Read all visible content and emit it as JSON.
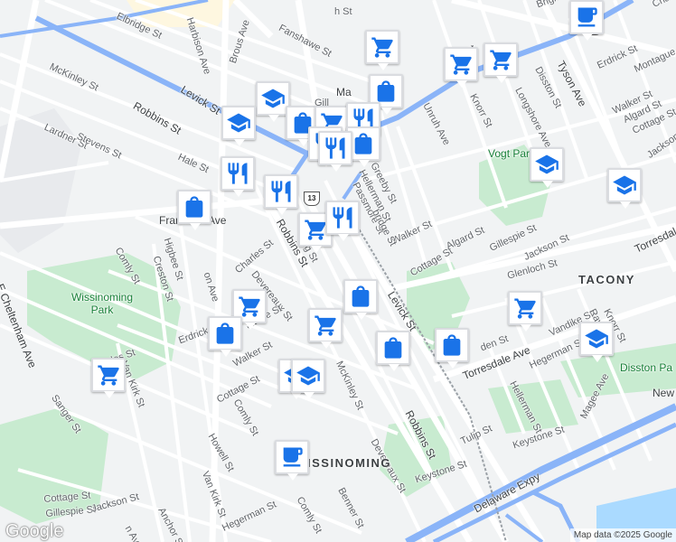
{
  "attribution": "Map data ©2025 Google",
  "logo": "Google",
  "shield_label": "13",
  "street_labels": [
    {
      "text": "Elbridge St",
      "key": "elbridge"
    },
    {
      "text": "Harbison Ave",
      "key": "harbison"
    },
    {
      "text": "Brous Ave",
      "key": "brous"
    },
    {
      "text": "Fanshawe St",
      "key": "fanshawe"
    },
    {
      "text": "Brighton St",
      "key": "brighton"
    },
    {
      "text": "McKinley St",
      "key": "mckinley1"
    },
    {
      "text": "Levick St",
      "key": "levick1"
    },
    {
      "text": "Robbins St",
      "key": "robbins1"
    },
    {
      "text": "Lardner St",
      "key": "lardner"
    },
    {
      "text": "Stevens St",
      "key": "stevens"
    },
    {
      "text": "Hale St",
      "key": "hale"
    },
    {
      "text": "Frankford Ave",
      "key": "frankford"
    },
    {
      "text": "Higbee St",
      "key": "higbee"
    },
    {
      "text": "Creston St",
      "key": "creston"
    },
    {
      "text": "Comly St",
      "key": "comly1"
    },
    {
      "text": "Charles St",
      "key": "charles"
    },
    {
      "text": "Devereaux St",
      "key": "devereaux1"
    },
    {
      "text": "Robbins St",
      "key": "robbins2"
    },
    {
      "text": "E Cheltenham Ave",
      "key": "cheltenham"
    },
    {
      "text": "Erdrick St",
      "key": "erdrick1"
    },
    {
      "text": "Walker St",
      "key": "walker1"
    },
    {
      "text": "Cottage St",
      "key": "cottage1"
    },
    {
      "text": "Comly St",
      "key": "comly2"
    },
    {
      "text": "Howell St",
      "key": "howell"
    },
    {
      "text": "Van Kirk St",
      "key": "vankirk1"
    },
    {
      "text": "Van Kirk St",
      "key": "vankirk2"
    },
    {
      "text": "Sanger St",
      "key": "sanger"
    },
    {
      "text": "Cottage St",
      "key": "cottage2"
    },
    {
      "text": "Gillespie St",
      "key": "gillespie1"
    },
    {
      "text": "Jackson St",
      "key": "jackson1"
    },
    {
      "text": "Anchor St",
      "key": "anchor"
    },
    {
      "text": "McKinley St",
      "key": "mckinley2"
    },
    {
      "text": "Devereaux St",
      "key": "devereaux2"
    },
    {
      "text": "Comly St",
      "key": "comly3"
    },
    {
      "text": "Benner St",
      "key": "benner"
    },
    {
      "text": "Robbins St",
      "key": "robbins3"
    },
    {
      "text": "Keystone St",
      "key": "keystone1"
    },
    {
      "text": "Tulip St",
      "key": "tulip"
    },
    {
      "text": "Levick St",
      "key": "levick2"
    },
    {
      "text": "Walker St",
      "key": "walker2"
    },
    {
      "text": "Cottage St",
      "key": "cottage3"
    },
    {
      "text": "Greeby St",
      "key": "greeby"
    },
    {
      "text": "Hellerman St",
      "key": "hellerman1"
    },
    {
      "text": "Passmore St",
      "key": "passmore"
    },
    {
      "text": "Unruh Ave",
      "key": "unruh"
    },
    {
      "text": "Knorr St",
      "key": "knorr1"
    },
    {
      "text": "Disston St",
      "key": "disston"
    },
    {
      "text": "Longshore Ave",
      "key": "longshore"
    },
    {
      "text": "Tyson Ave",
      "key": "tyson"
    },
    {
      "text": "Erdrick St",
      "key": "erdrick2"
    },
    {
      "text": "Montague St",
      "key": "montague"
    },
    {
      "text": "Walker St",
      "key": "walker3"
    },
    {
      "text": "Algard St",
      "key": "algard1"
    },
    {
      "text": "Cottage St",
      "key": "cottage4"
    },
    {
      "text": "Jackson St",
      "key": "jackson2"
    },
    {
      "text": "Algard St",
      "key": "algard2"
    },
    {
      "text": "Gillespie St",
      "key": "gillespie2"
    },
    {
      "text": "Jackson St",
      "key": "jackson3"
    },
    {
      "text": "Glenloch St",
      "key": "glenloch"
    },
    {
      "text": "Torresdale Ave",
      "key": "torresdale1"
    },
    {
      "text": "Torresdale Ave",
      "key": "torresdale2"
    },
    {
      "text": "Knorr St",
      "key": "knorr2"
    },
    {
      "text": "Vandike St",
      "key": "vandike"
    },
    {
      "text": "Hegerman St",
      "key": "hegerman1"
    },
    {
      "text": "Hellerman St",
      "key": "hellerman2"
    },
    {
      "text": "Magee Ave",
      "key": "magee"
    },
    {
      "text": "Keystone St",
      "key": "keystone2"
    },
    {
      "text": "Delaware Expy",
      "key": "delaware"
    },
    {
      "text": "Hegerman St",
      "key": "hegerman2"
    },
    {
      "text": "Chan",
      "key": "chan"
    },
    {
      "text": "Ma",
      "key": "ma"
    },
    {
      "text": "Gill",
      "key": "gill"
    },
    {
      "text": "bridge St",
      "key": "bridge"
    },
    {
      "text": "aitage St",
      "key": "aitage"
    },
    {
      "text": "rles St",
      "key": "rles"
    },
    {
      "text": "on Ave",
      "key": "onave1"
    },
    {
      "text": "n Ave",
      "key": "nave"
    },
    {
      "text": "New",
      "key": "newj"
    },
    {
      "text": "Rav",
      "key": "rav"
    },
    {
      "text": "den St",
      "key": "den"
    },
    {
      "text": "Ro",
      "key": "ro"
    },
    {
      "text": "ing St",
      "key": "ing"
    },
    {
      "text": "h St",
      "key": "hst"
    },
    {
      "text": "St",
      "key": "st1"
    }
  ],
  "area_labels": [
    {
      "text": "Wissinoming Park",
      "key": "wpark",
      "type": "park"
    },
    {
      "text": "Vogt Park",
      "key": "vogt",
      "type": "park"
    },
    {
      "text": "Disston Pa",
      "key": "disstonpark",
      "type": "park"
    },
    {
      "text": "TACONY",
      "key": "tacony",
      "type": "hood"
    },
    {
      "text": "ISSINOMING",
      "key": "wiss",
      "type": "hood"
    }
  ],
  "pois": [
    {
      "category": "shopping-cart",
      "key": "p1"
    },
    {
      "category": "shopping-cart",
      "key": "p2"
    },
    {
      "category": "shopping-cart",
      "key": "p3"
    },
    {
      "category": "shopping-bag",
      "key": "p4"
    },
    {
      "category": "school",
      "key": "p5"
    },
    {
      "category": "school",
      "key": "p6"
    },
    {
      "category": "shopping-bag",
      "key": "p7"
    },
    {
      "category": "shopping-cart",
      "key": "p8"
    },
    {
      "category": "restaurant",
      "key": "p9"
    },
    {
      "category": "shopping-bag",
      "key": "p10"
    },
    {
      "category": "restaurant",
      "key": "p11"
    },
    {
      "category": "restaurant",
      "key": "p12"
    },
    {
      "category": "restaurant",
      "key": "p13"
    },
    {
      "category": "shopping-bag",
      "key": "p14"
    },
    {
      "category": "restaurant",
      "key": "p15"
    },
    {
      "category": "shopping-cart",
      "key": "p16"
    },
    {
      "category": "restaurant",
      "key": "p17"
    },
    {
      "category": "shopping-bag",
      "key": "p18"
    },
    {
      "category": "shopping-cart",
      "key": "p19"
    },
    {
      "category": "shopping-cart",
      "key": "p20"
    },
    {
      "category": "shopping-bag",
      "key": "p21"
    },
    {
      "category": "shopping-bag",
      "key": "p22"
    },
    {
      "category": "shopping-cart",
      "key": "p23"
    },
    {
      "category": "school",
      "key": "p24"
    },
    {
      "category": "school",
      "key": "p25"
    },
    {
      "category": "school",
      "key": "p26"
    },
    {
      "category": "school",
      "key": "p27"
    },
    {
      "category": "shopping-cart",
      "key": "p28"
    },
    {
      "category": "school",
      "key": "p29"
    },
    {
      "category": "coffee",
      "key": "p30"
    },
    {
      "category": "shopping-bag",
      "key": "p31"
    },
    {
      "category": "coffee",
      "key": "p32"
    }
  ],
  "colors": {
    "pin_icon": "#1a73e8",
    "park": "#c8ebd0",
    "highway": "#8ab4f8",
    "water": "#aadaff"
  }
}
